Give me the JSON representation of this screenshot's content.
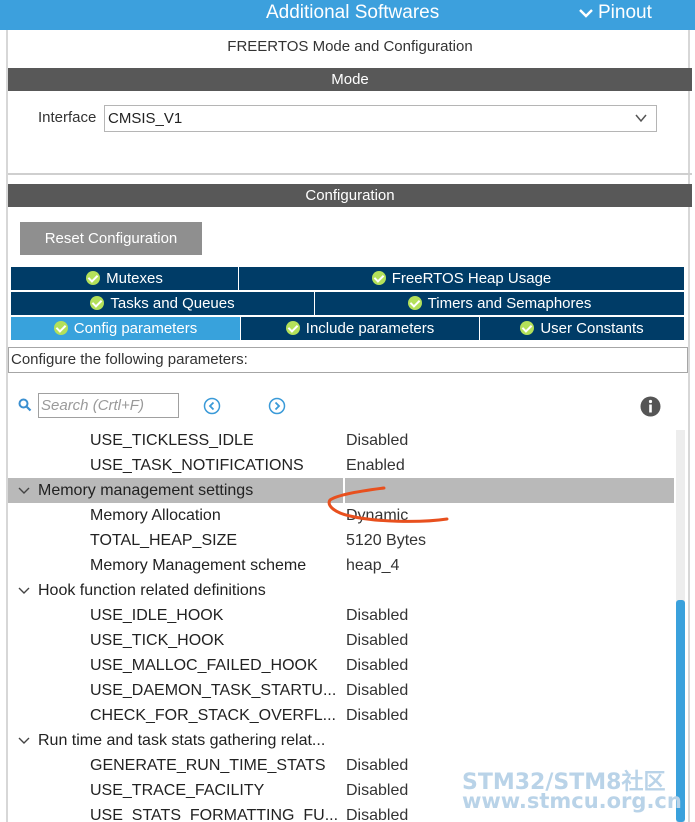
{
  "header": {
    "title": "Additional Softwares",
    "pinout_label": "Pinout"
  },
  "mode_section": {
    "title": "FREERTOS Mode and Configuration",
    "header": "Mode",
    "interface_label": "Interface",
    "interface_value": "CMSIS_V1"
  },
  "config_section": {
    "header": "Configuration",
    "reset_button": "Reset Configuration"
  },
  "tabs": {
    "mutexes": "Mutexes",
    "heap_usage": "FreeRTOS Heap Usage",
    "tasks_queues": "Tasks and Queues",
    "timers_semaphores": "Timers and Semaphores",
    "config_params": "Config parameters",
    "include_params": "Include parameters",
    "user_constants": "User Constants"
  },
  "configure_text": "Configure the following parameters:",
  "search": {
    "placeholder": "Search (Crtl+F)"
  },
  "params": [
    {
      "name": "USE_TICKLESS_IDLE",
      "value": "Disabled"
    },
    {
      "name": "USE_TASK_NOTIFICATIONS",
      "value": "Enabled"
    },
    {
      "name": "Memory management settings",
      "value": ""
    },
    {
      "name": "Memory Allocation",
      "value": "Dynamic"
    },
    {
      "name": "TOTAL_HEAP_SIZE",
      "value": "5120 Bytes"
    },
    {
      "name": "Memory Management scheme",
      "value": "heap_4"
    },
    {
      "name": "Hook function related definitions",
      "value": ""
    },
    {
      "name": "USE_IDLE_HOOK",
      "value": "Disabled"
    },
    {
      "name": "USE_TICK_HOOK",
      "value": "Disabled"
    },
    {
      "name": "USE_MALLOC_FAILED_HOOK",
      "value": "Disabled"
    },
    {
      "name": "USE_DAEMON_TASK_STARTU...",
      "value": "Disabled"
    },
    {
      "name": "CHECK_FOR_STACK_OVERFL...",
      "value": "Disabled"
    },
    {
      "name": "Run time and task stats gathering relat...",
      "value": ""
    },
    {
      "name": "GENERATE_RUN_TIME_STATS",
      "value": "Disabled"
    },
    {
      "name": "USE_TRACE_FACILITY",
      "value": "Disabled"
    },
    {
      "name": "USE_STATS_FORMATTING_FU...",
      "value": "Disabled"
    }
  ],
  "watermark": {
    "line1": "STM32/STM8社区",
    "line2": "www.stmcu.org.cn"
  },
  "colors": {
    "header_blue": "#3ca0dd",
    "tab_dark": "#003c67",
    "tab_active": "#38a2dc",
    "annotation": "#e8501e"
  }
}
